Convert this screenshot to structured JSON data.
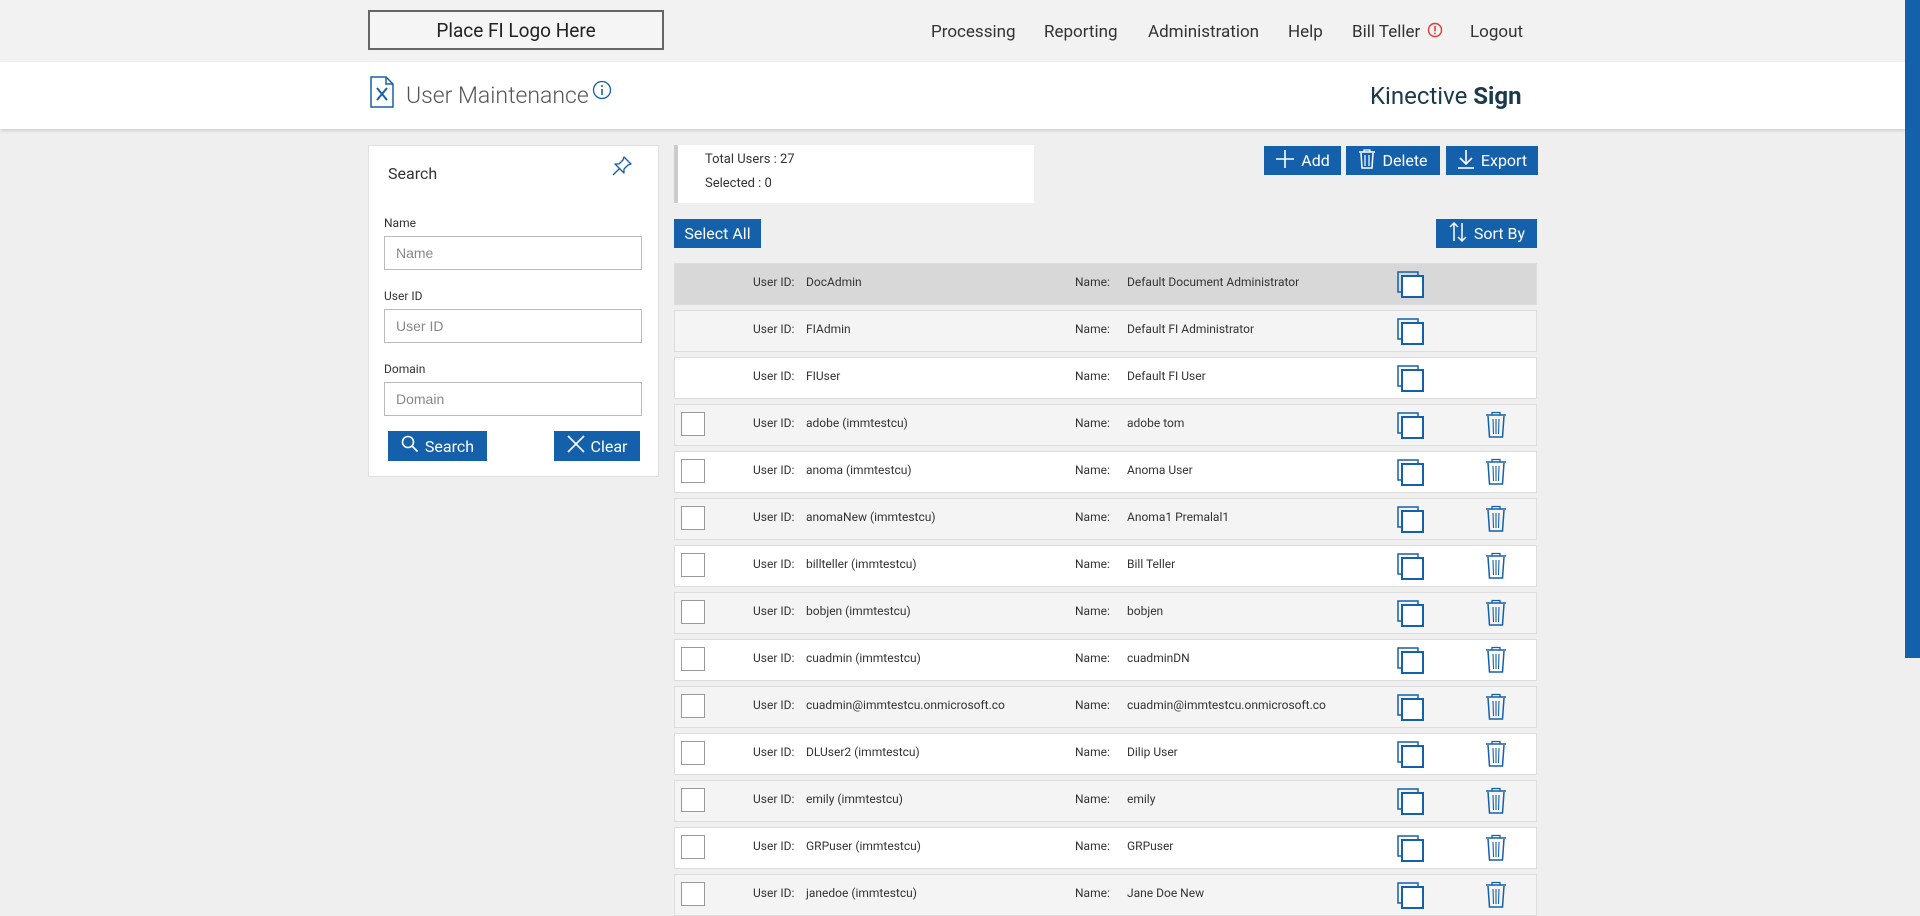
{
  "topbar": {
    "logo": "Place FI Logo Here",
    "nav": [
      {
        "key": "processing",
        "label": "Processing"
      },
      {
        "key": "reporting",
        "label": "Reporting"
      },
      {
        "key": "administration",
        "label": "Administration"
      },
      {
        "key": "help",
        "label": "Help"
      },
      {
        "key": "user",
        "label": "Bill Teller"
      },
      {
        "key": "logout",
        "label": "Logout"
      }
    ]
  },
  "header": {
    "title": "User Maintenance",
    "brand_light": "Kinective ",
    "brand_bold": "Sign"
  },
  "search": {
    "title": "Search",
    "name_label": "Name",
    "name_placeholder": "Name",
    "userid_label": "User ID",
    "userid_placeholder": "User ID",
    "domain_label": "Domain",
    "domain_placeholder": "Domain",
    "search_btn": "Search",
    "clear_btn": "Clear"
  },
  "summary": {
    "total": "Total Users : 27",
    "selected": "Selected : 0"
  },
  "toolbar": {
    "add": "Add",
    "delete": "Delete",
    "export": "Export",
    "select_all": "Select All",
    "sort_by": "Sort By"
  },
  "colors": {
    "accent": "#1460aa",
    "alert": "#e53935"
  },
  "table": {
    "uid_label": "User ID:",
    "name_label": "Name:",
    "rows": [
      {
        "uid": "DocAdmin",
        "name": "Default Document Administrator",
        "system": true,
        "selected": true
      },
      {
        "uid": "FIAdmin",
        "name": "Default FI Administrator",
        "system": true
      },
      {
        "uid": "FIUser",
        "name": "Default FI User",
        "system": true
      },
      {
        "uid": "adobe (immtestcu)",
        "name": "adobe tom"
      },
      {
        "uid": "anoma (immtestcu)",
        "name": "Anoma User"
      },
      {
        "uid": "anomaNew (immtestcu)",
        "name": "Anoma1 Premalal1"
      },
      {
        "uid": "billteller (immtestcu)",
        "name": "Bill Teller"
      },
      {
        "uid": "bobjen (immtestcu)",
        "name": "bobjen"
      },
      {
        "uid": "cuadmin (immtestcu)",
        "name": "cuadminDN"
      },
      {
        "uid": "cuadmin@immtestcu.onmicrosoft.co",
        "name": "cuadmin@immtestcu.onmicrosoft.co"
      },
      {
        "uid": "DLUser2 (immtestcu)",
        "name": "Dilip User"
      },
      {
        "uid": "emily (immtestcu)",
        "name": "emily"
      },
      {
        "uid": "GRPuser (immtestcu)",
        "name": "GRPuser"
      },
      {
        "uid": "janedoe (immtestcu)",
        "name": "Jane Doe New"
      }
    ]
  }
}
